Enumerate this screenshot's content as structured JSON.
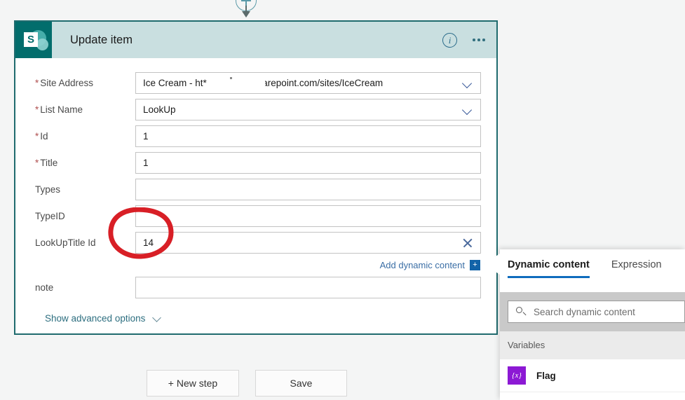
{
  "connector": {
    "add_step_label": "+"
  },
  "card": {
    "title": "Update item",
    "icon_letter": "S",
    "info_label": "i",
    "fields": [
      {
        "label": "Site Address",
        "required": true,
        "value": "Ice Cream - ht*",
        "value_tail": "harepoint.com/sites/IceCream",
        "control": "dropdown"
      },
      {
        "label": "List Name",
        "required": true,
        "value": "LookUp",
        "control": "dropdown"
      },
      {
        "label": "Id",
        "required": true,
        "value": "1",
        "control": "text"
      },
      {
        "label": "Title",
        "required": true,
        "value": "1",
        "control": "text"
      },
      {
        "label": "Types",
        "required": false,
        "value": "",
        "control": "text"
      },
      {
        "label": "TypeID",
        "required": false,
        "value": "",
        "control": "text"
      },
      {
        "label": "LookUpTitle Id",
        "required": false,
        "value": "14",
        "control": "text-clear"
      },
      {
        "label": "note",
        "required": false,
        "value": "",
        "control": "text"
      }
    ],
    "add_dynamic_content": "Add dynamic content",
    "add_dynamic_badge": "+",
    "show_advanced_options": "Show advanced options"
  },
  "buttons": {
    "new_step": "+ New step",
    "save": "Save"
  },
  "dynamic_panel": {
    "tabs": [
      {
        "label": "Dynamic content",
        "active": true
      },
      {
        "label": "Expression",
        "active": false
      }
    ],
    "search_placeholder": "Search dynamic content",
    "section_header": "Variables",
    "items": [
      {
        "label": "Flag",
        "icon_text": "{x}"
      }
    ]
  },
  "colors": {
    "card_border": "#1f6b6e",
    "header_band": "#c9dfe0",
    "sharepoint_teal": "#026d6c",
    "link_blue": "#3a6ea5",
    "tab_underline": "#0f6cbd",
    "variable_purple": "#8c19d4",
    "annotation_red": "#d81f26",
    "page_background": "#f4f5f5"
  }
}
